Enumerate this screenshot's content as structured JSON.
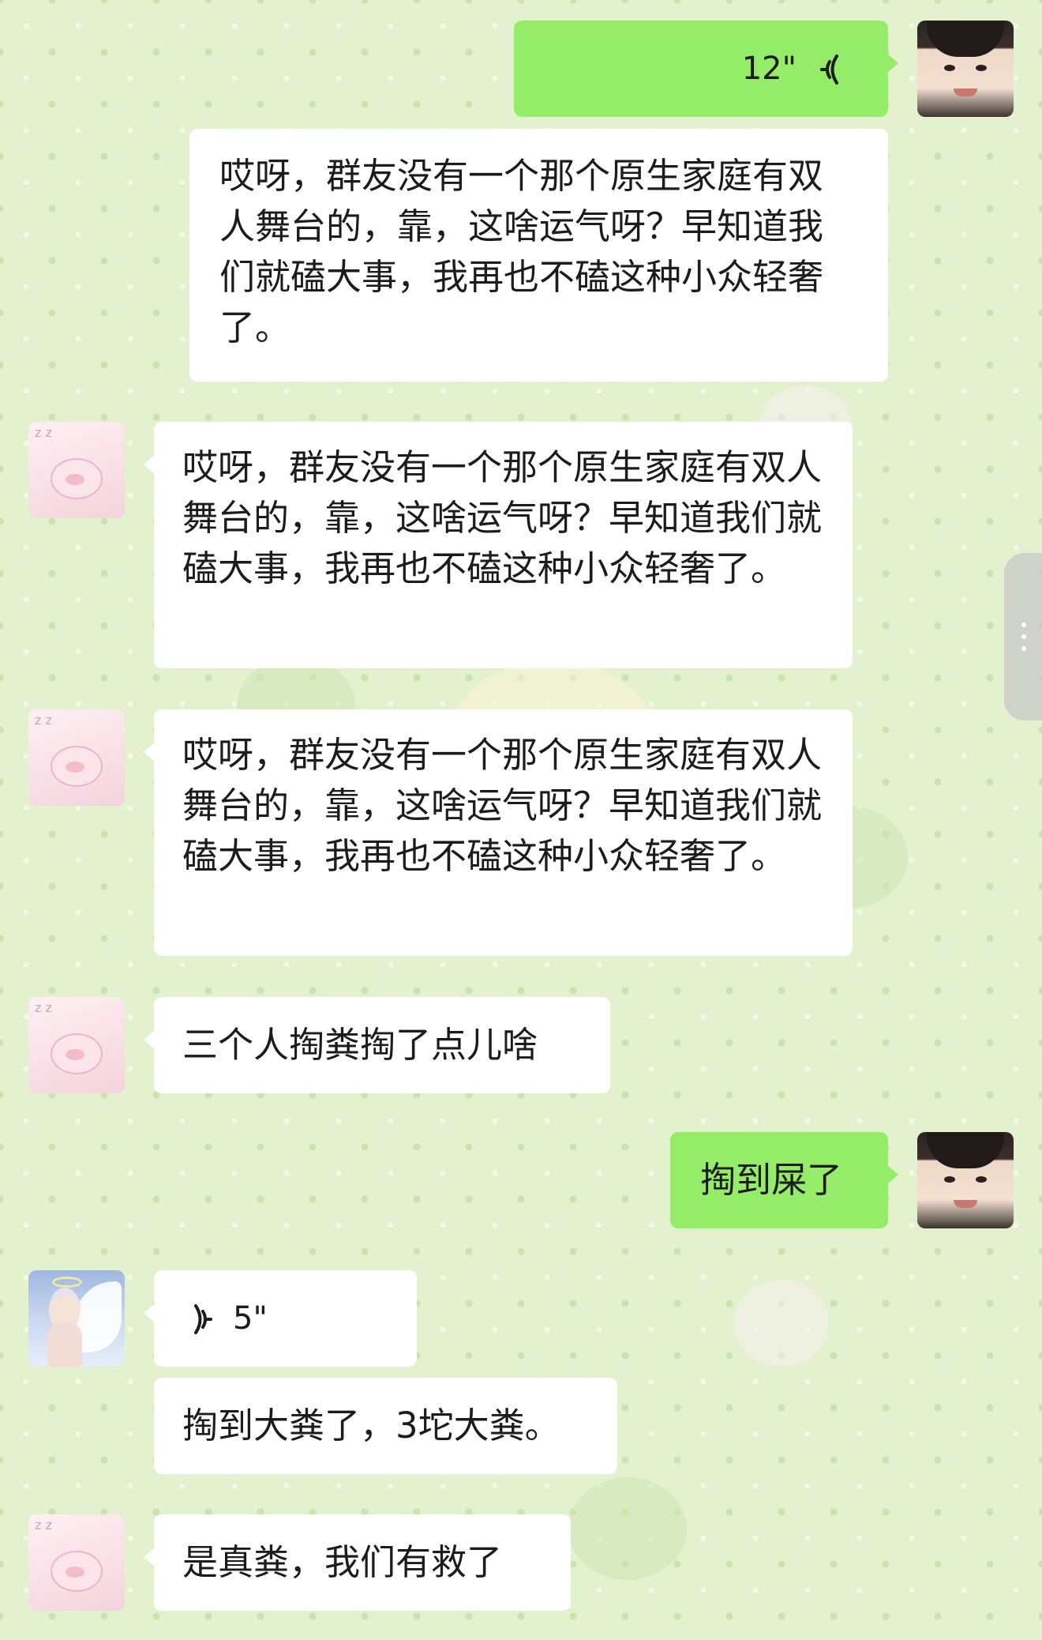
{
  "chat": {
    "messages": [
      {
        "side": "right",
        "avatar": "boy-avatar",
        "type": "voice",
        "duration": "12\""
      },
      {
        "side": "right",
        "avatar": "none",
        "type": "text",
        "text": "哎呀，群友没有一个那个原生家庭有双人舞台的，靠，这啥运气呀？早知道我们就磕大事，我再也不磕这种小众轻奢了。"
      },
      {
        "side": "left",
        "avatar": "pig-avatar",
        "type": "text",
        "text": "哎呀，群友没有一个那个原生家庭有双人舞台的，靠，这啥运气呀？早知道我们就磕大事，我再也不磕这种小众轻奢了。"
      },
      {
        "side": "left",
        "avatar": "pig-avatar",
        "type": "text",
        "text": "哎呀，群友没有一个那个原生家庭有双人舞台的，靠，这啥运气呀？早知道我们就磕大事，我再也不磕这种小众轻奢了。"
      },
      {
        "side": "left",
        "avatar": "pig-avatar",
        "type": "text",
        "text": "三个人掏粪掏了点儿啥"
      },
      {
        "side": "right",
        "avatar": "boy-avatar",
        "type": "text",
        "text": "掏到屎了"
      },
      {
        "side": "left",
        "avatar": "angel-avatar",
        "type": "voice",
        "duration": "5\""
      },
      {
        "side": "left",
        "avatar": "none",
        "type": "text",
        "text": "掏到大粪了，3坨大粪。"
      },
      {
        "side": "left",
        "avatar": "pig-avatar",
        "type": "text",
        "text": "是真粪，我们有救了"
      }
    ]
  },
  "icons": {
    "voice_wave_right": "voice-wave-icon",
    "voice_wave_left": "voice-wave-icon",
    "side_handle": "more-vertical-icon"
  },
  "colors": {
    "background": "#e3f1cf",
    "bubble_self": "#95ec69",
    "bubble_other": "#ffffff",
    "text": "#1c1c1c"
  }
}
